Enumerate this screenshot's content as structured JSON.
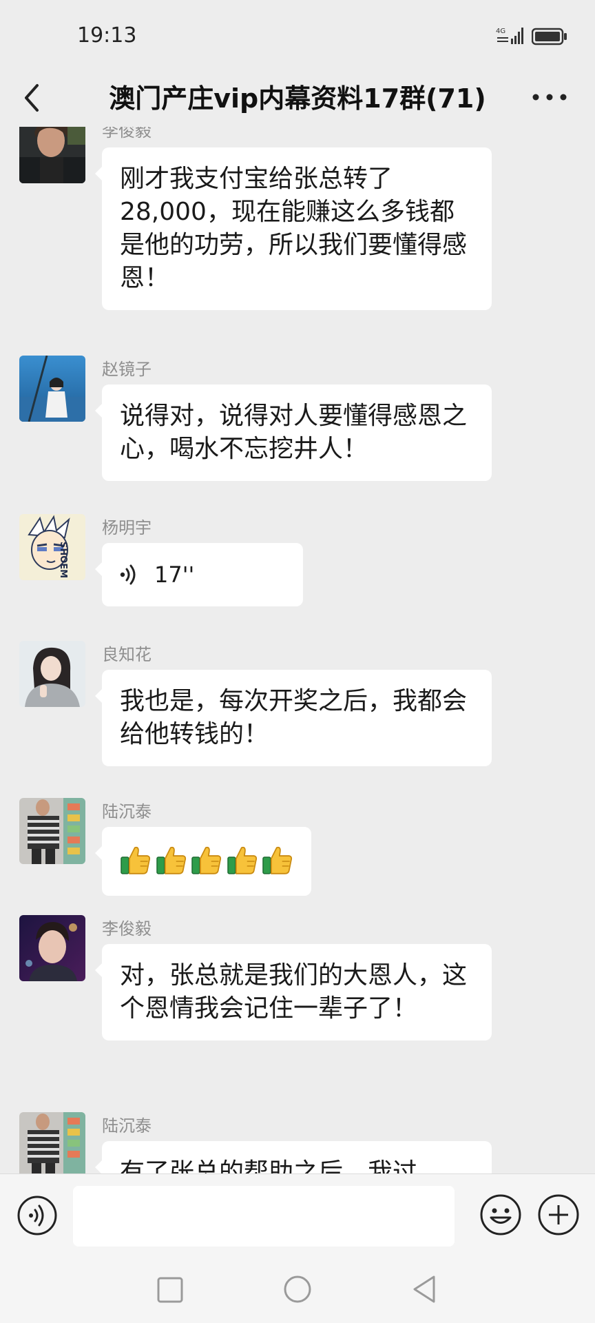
{
  "status_bar": {
    "time": "19:13",
    "network": "4G"
  },
  "header": {
    "title": "澳门产庄vip内幕资料17群(71)"
  },
  "messages": [
    {
      "sender": "李俊毅",
      "type": "text",
      "text": "刚才我支付宝给张总转了28,000，现在能赚这么多钱都是他的功劳，所以我们要懂得感恩！",
      "avatar": "young-man-portrait"
    },
    {
      "sender": "赵镜子",
      "type": "text",
      "text": "说得对，说得对人要懂得感恩之心，喝水不忘挖井人！",
      "avatar": "girl-by-sea"
    },
    {
      "sender": "杨明宇",
      "type": "voice",
      "duration": "17''",
      "avatar": "anime-character"
    },
    {
      "sender": "良知花",
      "type": "text",
      "text": "我也是，每次开奖之后，我都会给他转钱的！",
      "avatar": "girl-in-sweater"
    },
    {
      "sender": "陆沉泰",
      "type": "emoji",
      "emoji": "thumbs-up",
      "count": 5,
      "avatar": "striped-shirt-man"
    },
    {
      "sender": "李俊毅",
      "type": "text",
      "text": "对，张总就是我们的大恩人，这个恩情我会记住一辈子了！",
      "avatar": "young-man-night"
    },
    {
      "sender": "陆沉泰",
      "type": "text",
      "text": "有了张总的帮助之后，我过",
      "avatar": "striped-shirt-man"
    }
  ],
  "input_bar": {
    "text_value": ""
  },
  "colors": {
    "background": "#ededed",
    "bubble": "#ffffff",
    "sender_name": "#8f8f8f"
  }
}
